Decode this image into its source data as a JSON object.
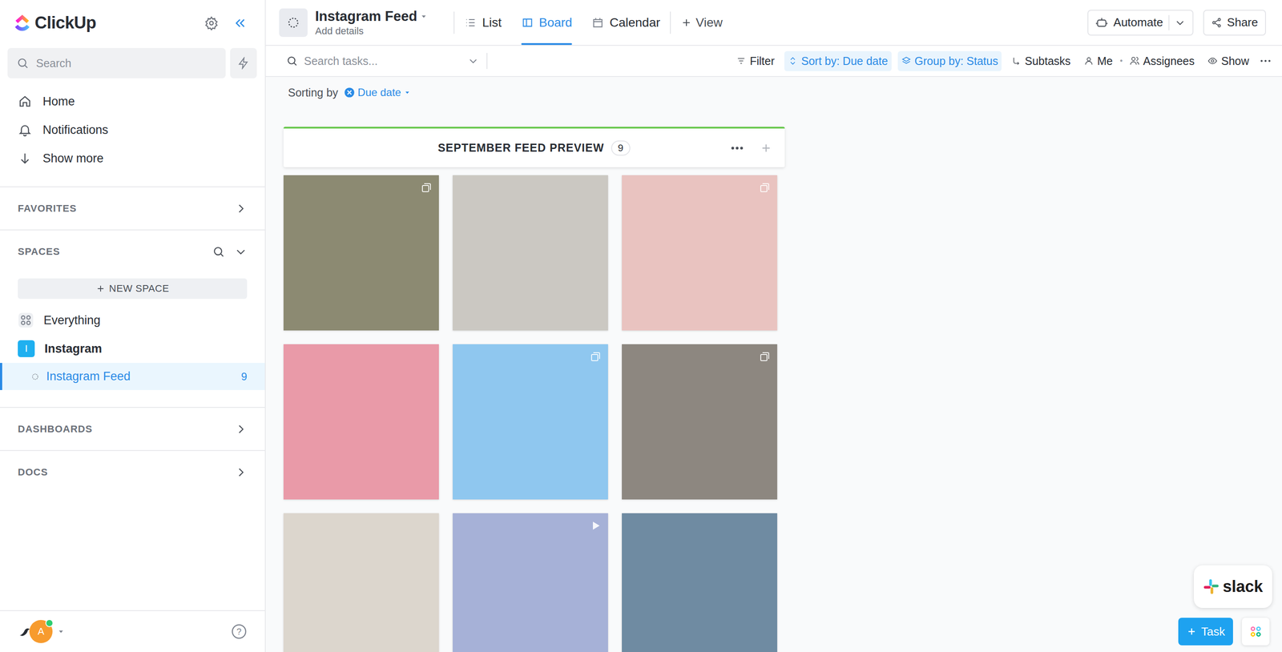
{
  "sidebar": {
    "logo": "ClickUp",
    "search": {
      "placeholder": "Search"
    },
    "nav": [
      {
        "label": "Home"
      },
      {
        "label": "Notifications"
      },
      {
        "label": "Show more"
      }
    ],
    "favorites": "FAVORITES",
    "spaces": {
      "title": "SPACES",
      "new_space": "NEW SPACE",
      "items": [
        {
          "kind": "everything",
          "label": "Everything",
          "selected": false
        },
        {
          "kind": "space",
          "label": "Instagram",
          "avatar": "I",
          "selected": false
        },
        {
          "kind": "list",
          "label": "Instagram Feed",
          "count": "9",
          "selected": true
        }
      ]
    },
    "sections": [
      "DASHBOARDS",
      "DOCS"
    ],
    "user": {
      "avatar": "A",
      "online": true
    },
    "help": "?"
  },
  "header": {
    "title": "Instagram Feed",
    "subtitle": "Add details",
    "views": [
      {
        "label": "List",
        "selected": false
      },
      {
        "label": "Board",
        "selected": true
      },
      {
        "label": "Calendar",
        "selected": false
      }
    ],
    "add_view": "View",
    "automate": "Automate",
    "share": "Share"
  },
  "toolbar": {
    "search_placeholder": "Search tasks...",
    "items": [
      {
        "kind": "button",
        "label": "Filter",
        "active": false
      },
      {
        "kind": "button",
        "label": "Sort by: Due date",
        "active": true
      },
      {
        "kind": "button",
        "label": "Group by: Status",
        "active": true
      },
      {
        "kind": "button",
        "label": "Subtasks",
        "active": false
      },
      {
        "kind": "button",
        "label": "Me",
        "active": false
      },
      {
        "kind": "separator",
        "label": "•",
        "active": false
      },
      {
        "kind": "button",
        "label": "Assignees",
        "active": false
      },
      {
        "kind": "button",
        "label": "Show",
        "active": false
      }
    ]
  },
  "sorting": {
    "label": "Sorting by",
    "value": "Due date"
  },
  "column": {
    "title": "SEPTEMBER FEED PREVIEW",
    "count": "9",
    "cards": [
      {
        "kind": "multi",
        "color": "#8c8a72"
      },
      {
        "kind": "none",
        "color": "#cbc8c2"
      },
      {
        "kind": "multi",
        "color": "#e9c3c0"
      },
      {
        "kind": "none",
        "color": "#e99aa8"
      },
      {
        "kind": "multi",
        "color": "#8fc7ef"
      },
      {
        "kind": "multi",
        "color": "#8d8780"
      },
      {
        "kind": "none",
        "color": "#dcd6cd"
      },
      {
        "kind": "video",
        "color": "#a6b1d7"
      },
      {
        "kind": "none",
        "color": "#6f8ba2"
      }
    ]
  },
  "slack": "slack",
  "new_task": "Task"
}
